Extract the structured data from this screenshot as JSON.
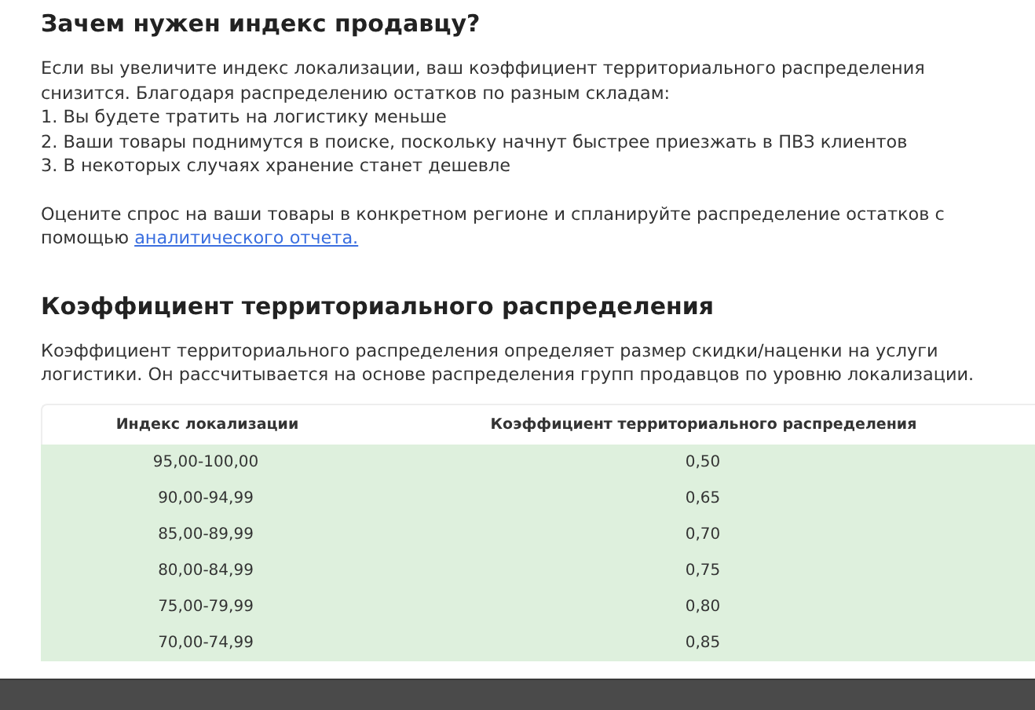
{
  "section_1": {
    "title": "Зачем нужен индекс продавцу?",
    "intro": "Если вы увеличите индекс локализации, ваш коэффициент территориального распределения снизится. Благодаря распределению остатков по разным складам:",
    "list": [
      "1. Вы будете тратить на логистику меньше",
      "2. Ваши товары поднимутся в поиске, поскольку начнут быстрее приезжать в ПВЗ клиентов",
      "3. В некоторых случаях хранение станет дешевле"
    ],
    "note": "Оцените спрос на ваши товары в конкретном регионе и спланируйте распределение остатков с помощью",
    "link": "аналитического отчета."
  },
  "section_2": {
    "title": "Коэффициент территориального распределения",
    "description": "Коэффициент территориального распределения определяет размер скидки/наценки на услуги логистики. Он рассчитывается на основе распределения групп продавцов по уровню локализации.",
    "table": {
      "columns": [
        "Индекс локализации",
        "Коэффициент территориального распределения"
      ],
      "rows": [
        [
          "95,00-100,00",
          "0,50"
        ],
        [
          "90,00-94,99",
          "0,65"
        ],
        [
          "85,00-89,99",
          "0,70"
        ],
        [
          "80,00-84,99",
          "0,75"
        ],
        [
          "75,00-79,99",
          "0,80"
        ],
        [
          "70,00-74,99",
          "0,85"
        ]
      ]
    }
  }
}
